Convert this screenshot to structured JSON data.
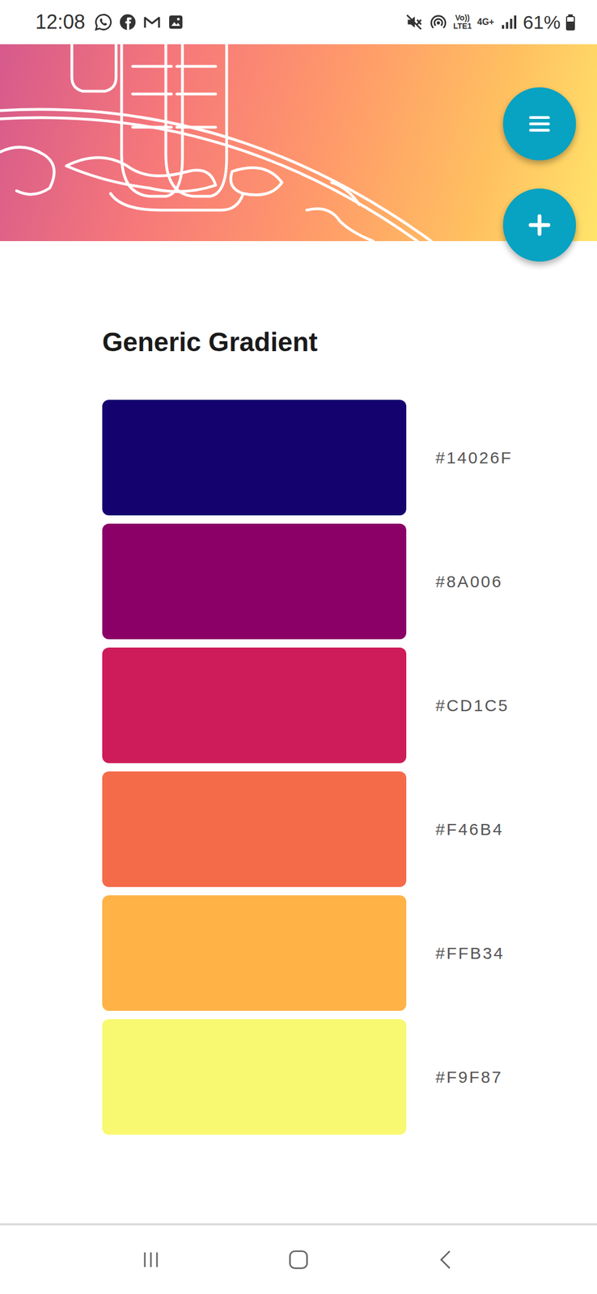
{
  "status_bar": {
    "time": "12:08",
    "volte": "Vo))",
    "lte": "LTE1",
    "network": "4G+",
    "battery": "61%",
    "level": 0.61
  },
  "palette": {
    "title": "Generic Gradient",
    "swatches": [
      {
        "hex": "#14026F",
        "color": "#14026F"
      },
      {
        "hex": "#8A006",
        "color": "#8A0066"
      },
      {
        "hex": "#CD1C5",
        "color": "#CD1C59"
      },
      {
        "hex": "#F46B4",
        "color": "#F46B4A"
      },
      {
        "hex": "#FFB34",
        "color": "#FFB347"
      },
      {
        "hex": "#F9F87",
        "color": "#F8F871"
      }
    ]
  }
}
